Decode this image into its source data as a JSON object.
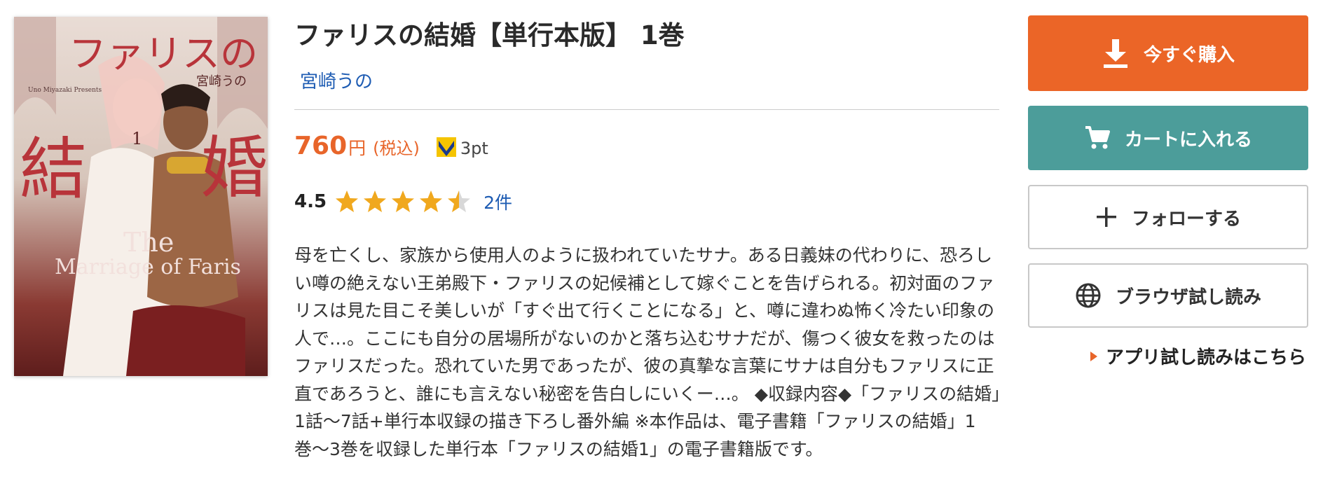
{
  "cover": {
    "title_top": "ファリスの",
    "kanji_left": "結",
    "kanji_right": "婚",
    "author": "宮崎うの",
    "english_line1": "The",
    "english_line2": "Marriage of Faris",
    "volume": "1",
    "presents": "Uno Miyazaki Presents"
  },
  "product": {
    "title": "ファリスの結婚【単行本版】 1巻",
    "author": "宮崎うの"
  },
  "price": {
    "amount": "760",
    "unit": "円",
    "tax_note": "(税込)",
    "points": "3pt"
  },
  "rating": {
    "score": "4.5",
    "score_value": 4.5,
    "max": 5,
    "review_count": "2件"
  },
  "description": "母を亡くし、家族から使用人のように扱われていたサナ。ある日義妹の代わりに、恐ろしい噂の絶えない王弟殿下・ファリスの妃候補として嫁ぐことを告げられる。初対面のファリスは見た目こそ美しいが「すぐ出て行くことになる」と、噂に違わぬ怖く冷たい印象の人で…。ここにも自分の居場所がないのかと落ち込むサナだが、傷つく彼女を救ったのはファリスだった。恐れていた男であったが、彼の真摯な言葉にサナは自分もファリスに正直であろうと、誰にも言えない秘密を告白しにいくー…。 ◆収録内容◆「ファリスの結婚」1話〜7話+単行本収録の描き下ろし番外編 ※本作品は、電子書籍「ファリスの結婚」1巻〜3巻を収録した単行本「ファリスの結婚1」の電子書籍版です。",
  "actions": {
    "buy_now": "今すぐ購入",
    "add_to_cart": "カートに入れる",
    "follow": "フォローする",
    "browser_trial": "ブラウザ試し読み",
    "app_trial": "アプリ試し読みはこちら"
  },
  "colors": {
    "accent_orange": "#eb6527",
    "cart_teal": "#4c9d9a",
    "link_blue": "#1e5cb3",
    "star_gold": "#f0a81e"
  }
}
